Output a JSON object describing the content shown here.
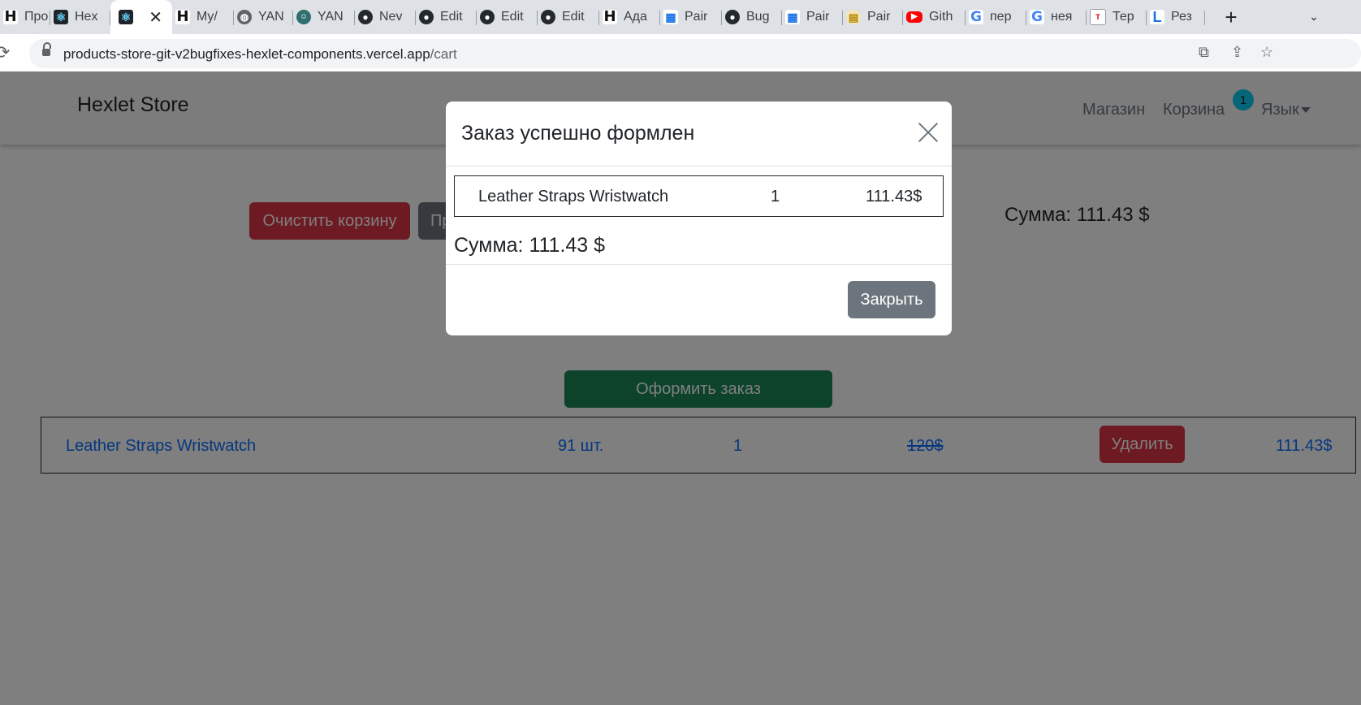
{
  "browser": {
    "tabs": [
      {
        "title": "Про",
        "icon": "hexlet-icon",
        "glyph": "H",
        "cls": "hexlet"
      },
      {
        "title": "Hex",
        "icon": "react-icon",
        "glyph": "⚛",
        "cls": "react"
      },
      {
        "title": "",
        "icon": "react-icon",
        "glyph": "⚛",
        "cls": "react",
        "active": true
      },
      {
        "title": "My/",
        "icon": "hexlet-icon",
        "glyph": "H",
        "cls": "hexlet"
      },
      {
        "title": "YAN",
        "icon": "globe-icon",
        "glyph": "◍",
        "cls": "globe"
      },
      {
        "title": "YAN",
        "icon": "avatar-icon",
        "glyph": "☺",
        "cls": "avatar"
      },
      {
        "title": "Nev",
        "icon": "github-icon",
        "glyph": "●",
        "cls": "github"
      },
      {
        "title": "Edit",
        "icon": "github-icon",
        "glyph": "●",
        "cls": "github"
      },
      {
        "title": "Edit",
        "icon": "github-icon",
        "glyph": "●",
        "cls": "github"
      },
      {
        "title": "Edit",
        "icon": "github-icon",
        "glyph": "●",
        "cls": "github"
      },
      {
        "title": "Ада",
        "icon": "hexlet-icon",
        "glyph": "H",
        "cls": "hexlet"
      },
      {
        "title": "Pair",
        "icon": "sheet-icon",
        "glyph": "▦",
        "cls": "sheet"
      },
      {
        "title": "Bug",
        "icon": "github-icon",
        "glyph": "●",
        "cls": "github"
      },
      {
        "title": "Pair",
        "icon": "sheet-icon",
        "glyph": "▦",
        "cls": "sheet"
      },
      {
        "title": "Pair",
        "icon": "book-icon",
        "glyph": "▤",
        "cls": "book"
      },
      {
        "title": "Gith",
        "icon": "youtube-icon",
        "glyph": "▶",
        "cls": "yt"
      },
      {
        "title": "пер",
        "icon": "google-icon",
        "glyph": "G",
        "cls": "g"
      },
      {
        "title": "нея",
        "icon": "google-icon",
        "glyph": "G",
        "cls": "g"
      },
      {
        "title": "Тер",
        "icon": "ter-icon",
        "glyph": "T",
        "cls": "ter"
      },
      {
        "title": "Рез",
        "icon": "l-icon",
        "glyph": "L",
        "cls": "linkedl"
      }
    ],
    "new_tab": "+",
    "tab_search": "⌄",
    "url_host": "products-store-git-v2bugfixes-hexlet-components.vercel.app",
    "url_path": "/cart"
  },
  "navbar": {
    "brand": "Hexlet Store",
    "shop": "Магазин",
    "cart": "Корзина",
    "cart_count": "1",
    "language": "Язык"
  },
  "cart": {
    "clear_button": "Очистить корзину",
    "second_button": "Пр",
    "sum": "Сумма: 111.43 $",
    "order_button": "Оформить заказ",
    "item": {
      "name": "Leather Straps Wristwatch",
      "stock": "91 шт.",
      "qty": "1",
      "old_price": "120$",
      "delete": "Удалить",
      "price": "111.43$"
    }
  },
  "modal": {
    "title": "Заказ успешно формлен",
    "item_name": "Leather Straps Wristwatch",
    "item_qty": "1",
    "item_price": "111.43$",
    "sum": "Сумма: 111.43 $",
    "close_button": "Закрыть"
  },
  "colors": {
    "danger": "#dc3545",
    "secondary": "#6c757d",
    "success": "#198754",
    "link": "#0d6efd",
    "badge": "#0dcaf0"
  }
}
